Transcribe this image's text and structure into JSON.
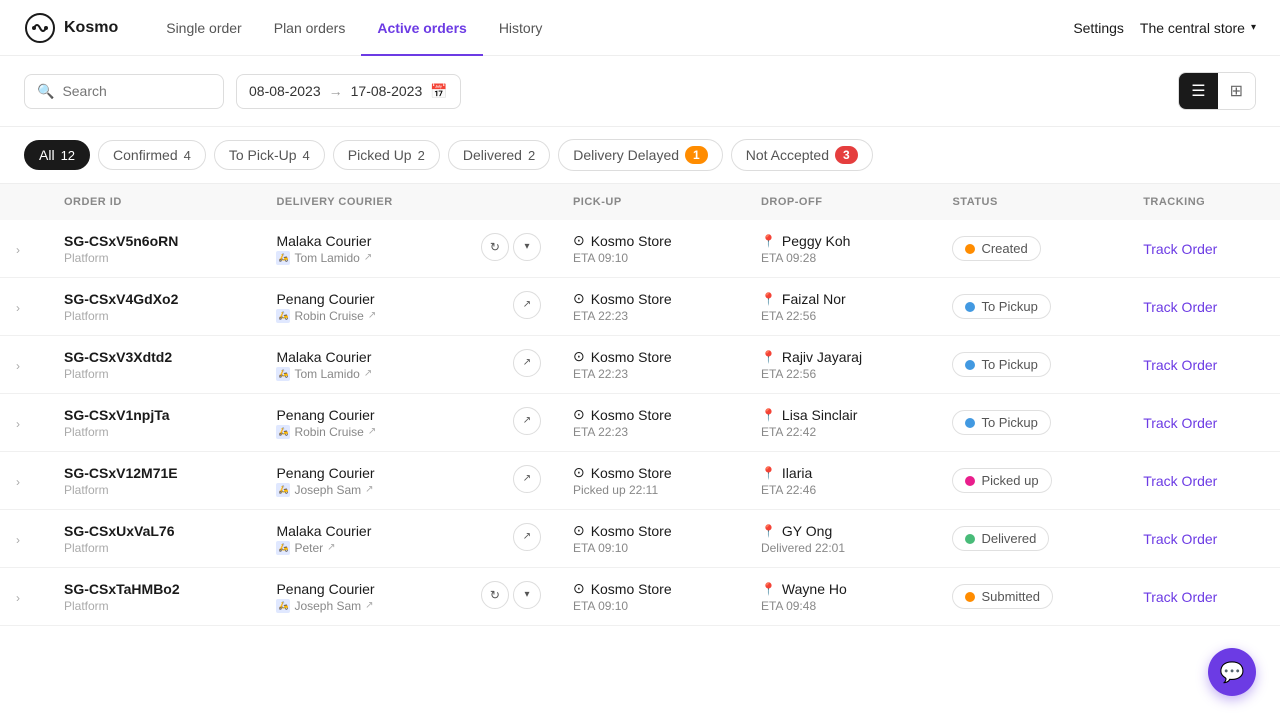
{
  "header": {
    "logo_text": "Kosmo",
    "nav_items": [
      {
        "label": "Single order",
        "active": false
      },
      {
        "label": "Plan orders",
        "active": false
      },
      {
        "label": "Active orders",
        "active": true
      },
      {
        "label": "History",
        "active": false
      }
    ],
    "settings_label": "Settings",
    "store_name": "The central store"
  },
  "toolbar": {
    "search_placeholder": "Search",
    "date_from": "08-08-2023",
    "date_to": "17-08-2023"
  },
  "filters": [
    {
      "label": "All",
      "count": "12",
      "active": true,
      "badge": null
    },
    {
      "label": "Confirmed",
      "count": "4",
      "active": false,
      "badge": null
    },
    {
      "label": "To Pick-Up",
      "count": "4",
      "active": false,
      "badge": null
    },
    {
      "label": "Picked Up",
      "count": "2",
      "active": false,
      "badge": null
    },
    {
      "label": "Delivered",
      "count": "2",
      "active": false,
      "badge": null
    },
    {
      "label": "Delivery Delayed",
      "count": "1",
      "active": false,
      "badge": "orange"
    },
    {
      "label": "Not Accepted",
      "count": "3",
      "active": false,
      "badge": "red"
    }
  ],
  "table": {
    "columns": [
      "",
      "ORDER ID",
      "DELIVERY COURIER",
      "PICK-UP",
      "DROP-OFF",
      "STATUS",
      "TRACKING"
    ],
    "rows": [
      {
        "id": "SG-CSxV5n6oRN",
        "sub": "Platform",
        "courier_company": "Malaka Courier",
        "courier_name": "Tom Lamido",
        "has_refresh": true,
        "pickup_name": "Kosmo Store",
        "pickup_eta": "ETA 09:10",
        "dropoff_name": "Peggy Koh",
        "dropoff_eta": "ETA 09:28",
        "status": "Created",
        "status_dot": "orange",
        "track": "Track Order"
      },
      {
        "id": "SG-CSxV4GdXo2",
        "sub": "Platform",
        "courier_company": "Penang Courier",
        "courier_name": "Robin Cruise",
        "has_refresh": false,
        "pickup_name": "Kosmo Store",
        "pickup_eta": "ETA 22:23",
        "dropoff_name": "Faizal Nor",
        "dropoff_eta": "ETA 22:56",
        "status": "To Pickup",
        "status_dot": "blue",
        "track": "Track Order"
      },
      {
        "id": "SG-CSxV3Xdtd2",
        "sub": "Platform",
        "courier_company": "Malaka Courier",
        "courier_name": "Tom Lamido",
        "has_refresh": false,
        "pickup_name": "Kosmo Store",
        "pickup_eta": "ETA 22:23",
        "dropoff_name": "Rajiv Jayaraj",
        "dropoff_eta": "ETA 22:56",
        "status": "To Pickup",
        "status_dot": "blue",
        "track": "Track Order"
      },
      {
        "id": "SG-CSxV1npjTa",
        "sub": "Platform",
        "courier_company": "Penang Courier",
        "courier_name": "Robin Cruise",
        "has_refresh": false,
        "pickup_name": "Kosmo Store",
        "pickup_eta": "ETA 22:23",
        "dropoff_name": "Lisa Sinclair",
        "dropoff_eta": "ETA 22:42",
        "status": "To Pickup",
        "status_dot": "blue",
        "track": "Track Order"
      },
      {
        "id": "SG-CSxV12M71E",
        "sub": "Platform",
        "courier_company": "Penang Courier",
        "courier_name": "Joseph Sam",
        "has_refresh": false,
        "pickup_name": "Kosmo Store",
        "pickup_eta": "Picked up 22:11",
        "dropoff_name": "Ilaria",
        "dropoff_eta": "ETA 22:46",
        "status": "Picked up",
        "status_dot": "pink",
        "track": "Track Order"
      },
      {
        "id": "SG-CSxUxVaL76",
        "sub": "Platform",
        "courier_company": "Malaka Courier",
        "courier_name": "Peter",
        "has_refresh": false,
        "pickup_name": "Kosmo Store",
        "pickup_eta": "ETA 09:10",
        "dropoff_name": "GY Ong",
        "dropoff_eta": "Delivered 22:01",
        "status": "Delivered",
        "status_dot": "green",
        "track": "Track Order"
      },
      {
        "id": "SG-CSxTaHMBo2",
        "sub": "Platform",
        "courier_company": "Penang Courier",
        "courier_name": "Joseph Sam",
        "has_refresh": true,
        "pickup_name": "Kosmo Store",
        "pickup_eta": "ETA 09:10",
        "dropoff_name": "Wayne Ho",
        "dropoff_eta": "ETA 09:48",
        "status": "Submitted",
        "status_dot": "orange",
        "track": "Track Order"
      }
    ]
  }
}
